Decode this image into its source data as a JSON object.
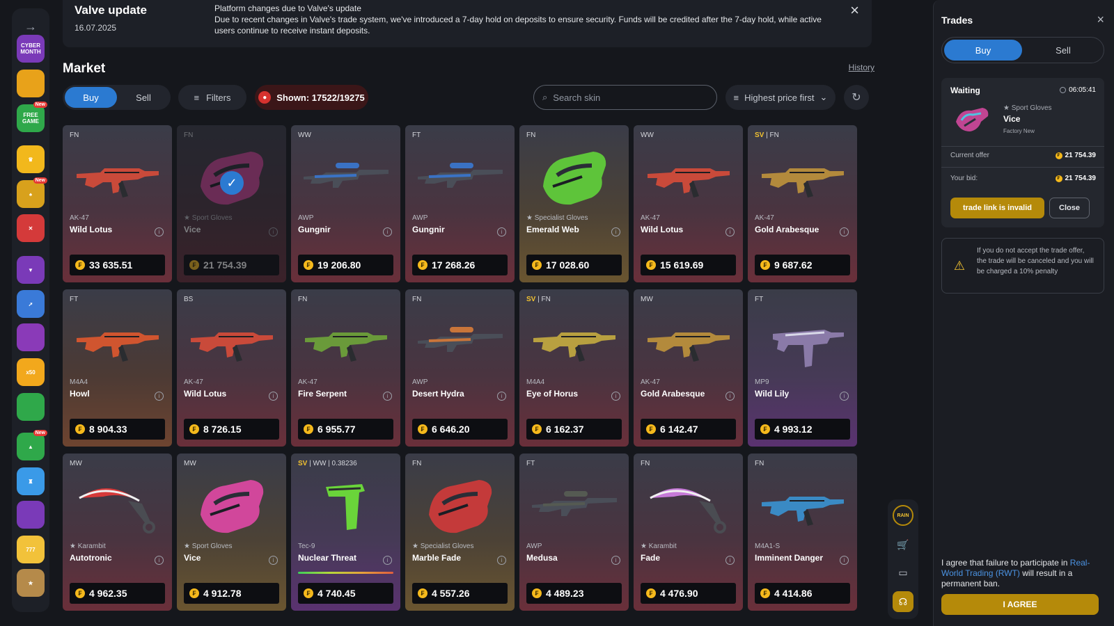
{
  "banner": {
    "title": "Valve update",
    "date": "16.07.2025",
    "heading": "Platform changes due to Valve's update",
    "message": "Due to recent changes in Valve's trade system, we've introduced a 7-day hold on deposits to ensure security. Funds will be credited after the 7-day hold, while active users continue to receive instant deposits."
  },
  "market": {
    "title": "Market",
    "history_label": "History",
    "buy_label": "Buy",
    "sell_label": "Sell",
    "filters_label": "Filters",
    "shown_label": "Shown: 17522/19275",
    "search_placeholder": "Search skin",
    "sort_label": "Highest price first"
  },
  "items": [
    {
      "wear": "FN",
      "sv": "",
      "category": "AK-47",
      "name": "Wild Lotus",
      "price": "33 635.51",
      "color": "#c94a3a",
      "kind": "rifle",
      "bg": "red"
    },
    {
      "wear": "FN",
      "sv": "",
      "category": "★ Sport Gloves",
      "name": "Vice",
      "price": "21 754.39",
      "color": "#d1479b",
      "kind": "glove",
      "bg": "red",
      "selected": true
    },
    {
      "wear": "WW",
      "sv": "",
      "category": "AWP",
      "name": "Gungnir",
      "price": "19 206.80",
      "color": "#3a72c4",
      "kind": "sniper",
      "bg": "red"
    },
    {
      "wear": "FT",
      "sv": "",
      "category": "AWP",
      "name": "Gungnir",
      "price": "17 268.26",
      "color": "#3a72c4",
      "kind": "sniper",
      "bg": "red"
    },
    {
      "wear": "FN",
      "sv": "",
      "category": "★ Specialist Gloves",
      "name": "Emerald Web",
      "price": "17 028.60",
      "color": "#5ec43a",
      "kind": "glove",
      "bg": "gold"
    },
    {
      "wear": "WW",
      "sv": "",
      "category": "AK-47",
      "name": "Wild Lotus",
      "price": "15 619.69",
      "color": "#c94a3a",
      "kind": "rifle",
      "bg": "red"
    },
    {
      "wear": "FN",
      "sv": "SV",
      "category": "AK-47",
      "name": "Gold Arabesque",
      "price": "9 687.62",
      "color": "#b38a3c",
      "kind": "rifle",
      "bg": "red"
    },
    {
      "wear": "FT",
      "sv": "",
      "category": "M4A4",
      "name": "Howl",
      "price": "8 904.33",
      "color": "#d0552f",
      "kind": "rifle",
      "bg": "orange"
    },
    {
      "wear": "BS",
      "sv": "",
      "category": "AK-47",
      "name": "Wild Lotus",
      "price": "8 726.15",
      "color": "#c94a3a",
      "kind": "rifle",
      "bg": "red"
    },
    {
      "wear": "FN",
      "sv": "",
      "category": "AK-47",
      "name": "Fire Serpent",
      "price": "6 955.77",
      "color": "#6a9a3a",
      "kind": "rifle",
      "bg": "red"
    },
    {
      "wear": "FN",
      "sv": "",
      "category": "AWP",
      "name": "Desert Hydra",
      "price": "6 646.20",
      "color": "#c9753a",
      "kind": "sniper",
      "bg": "red"
    },
    {
      "wear": "FN",
      "sv": "SV",
      "category": "M4A4",
      "name": "Eye of Horus",
      "price": "6 162.37",
      "color": "#b8a040",
      "kind": "rifle",
      "bg": "red"
    },
    {
      "wear": "MW",
      "sv": "",
      "category": "AK-47",
      "name": "Gold Arabesque",
      "price": "6 142.47",
      "color": "#b38a3c",
      "kind": "rifle",
      "bg": "red"
    },
    {
      "wear": "FT",
      "sv": "",
      "category": "MP9",
      "name": "Wild Lily",
      "price": "4 993.12",
      "color": "#8a7aa8",
      "kind": "smg",
      "bg": "purple"
    },
    {
      "wear": "MW",
      "sv": "",
      "category": "★ Karambit",
      "name": "Autotronic",
      "price": "4 962.35",
      "color": "#d63a3a",
      "kind": "knife",
      "bg": "red"
    },
    {
      "wear": "MW",
      "sv": "",
      "category": "★ Sport Gloves",
      "name": "Vice",
      "price": "4 912.78",
      "color": "#d1479b",
      "kind": "glove",
      "bg": "gold"
    },
    {
      "wear": "WW | 0.38236",
      "sv": "SV",
      "category": "Tec-9",
      "name": "Nuclear Threat",
      "price": "4 740.45",
      "color": "#6ad43a",
      "kind": "pistol",
      "bg": "purple",
      "floatbar": true
    },
    {
      "wear": "FN",
      "sv": "",
      "category": "★ Specialist Gloves",
      "name": "Marble Fade",
      "price": "4 557.26",
      "color": "#c43a3a",
      "kind": "glove",
      "bg": "gold"
    },
    {
      "wear": "FT",
      "sv": "",
      "category": "AWP",
      "name": "Medusa",
      "price": "4 489.23",
      "color": "#555a52",
      "kind": "sniper",
      "bg": "red"
    },
    {
      "wear": "FN",
      "sv": "",
      "category": "★ Karambit",
      "name": "Fade",
      "price": "4 476.90",
      "color": "#c67ad8",
      "kind": "knife",
      "bg": "red"
    },
    {
      "wear": "FN",
      "sv": "",
      "category": "M4A1-S",
      "name": "Imminent Danger",
      "price": "4 414.86",
      "color": "#3a8ac4",
      "kind": "rifle",
      "bg": "red"
    }
  ],
  "trades": {
    "title": "Trades",
    "buy_label": "Buy",
    "sell_label": "Sell",
    "status": "Waiting",
    "timer": "06:05:41",
    "item_category": "★ Sport Gloves",
    "item_name": "Vice",
    "item_quality": "Factory New",
    "current_offer_label": "Current offer",
    "current_offer_value": "21 754.39",
    "your_bid_label": "Your bid:",
    "your_bid_value": "21 754.39",
    "invalid_label": "trade link is invalid",
    "close_label": "Close",
    "warning": "If you do not accept the trade offer, the trade will be canceled and you will be charged a 10% penalty",
    "agree_pre": "I agree that failure to participate in",
    "agree_link": "Real-World Trading (RWT)",
    "agree_post": "will result in a permanent ban.",
    "agree_button": "I AGREE"
  },
  "rail": {
    "icons": [
      {
        "name": "cyber-month-icon",
        "label": "CYBER MONTH",
        "color": "#7a3ab8",
        "new": false
      },
      {
        "name": "tickets-icon",
        "label": "",
        "color": "#e8a21a",
        "new": false
      },
      {
        "name": "free-game-icon",
        "label": "FREE GAME",
        "color": "#2fa84a",
        "new": true
      },
      {
        "name": "crown-icon",
        "label": "♛",
        "color": "#f2b81c",
        "new": false
      },
      {
        "name": "cards-icon",
        "label": "♠",
        "color": "#d8a11c",
        "new": true
      },
      {
        "name": "swords-icon",
        "label": "✕",
        "color": "#d43a3a",
        "new": false
      },
      {
        "name": "upgrade-icon",
        "label": "▼",
        "color": "#7a3ab8",
        "new": false
      },
      {
        "name": "crash-icon",
        "label": "➚",
        "color": "#3a7ad8",
        "new": false
      },
      {
        "name": "wheel-icon",
        "label": "",
        "color": "#8a3ab8",
        "new": false
      },
      {
        "name": "x50-icon",
        "label": "x50",
        "color": "#f2a81c",
        "new": false
      },
      {
        "name": "coinflip-icon",
        "label": "",
        "color": "#2fa84a",
        "new": false
      },
      {
        "name": "plinko-icon",
        "label": "▲",
        "color": "#2fa84a",
        "new": true
      },
      {
        "name": "tower-icon",
        "label": "♜",
        "color": "#3a9ae8",
        "new": false
      },
      {
        "name": "battle-icon",
        "label": "",
        "color": "#7a3ab8",
        "new": false
      },
      {
        "name": "slots-icon",
        "label": "777",
        "color": "#f2c23a",
        "new": false
      },
      {
        "name": "star-icon",
        "label": "★",
        "color": "#b58a4a",
        "new": false
      }
    ]
  },
  "util": {
    "rain_label": "RAIN"
  }
}
